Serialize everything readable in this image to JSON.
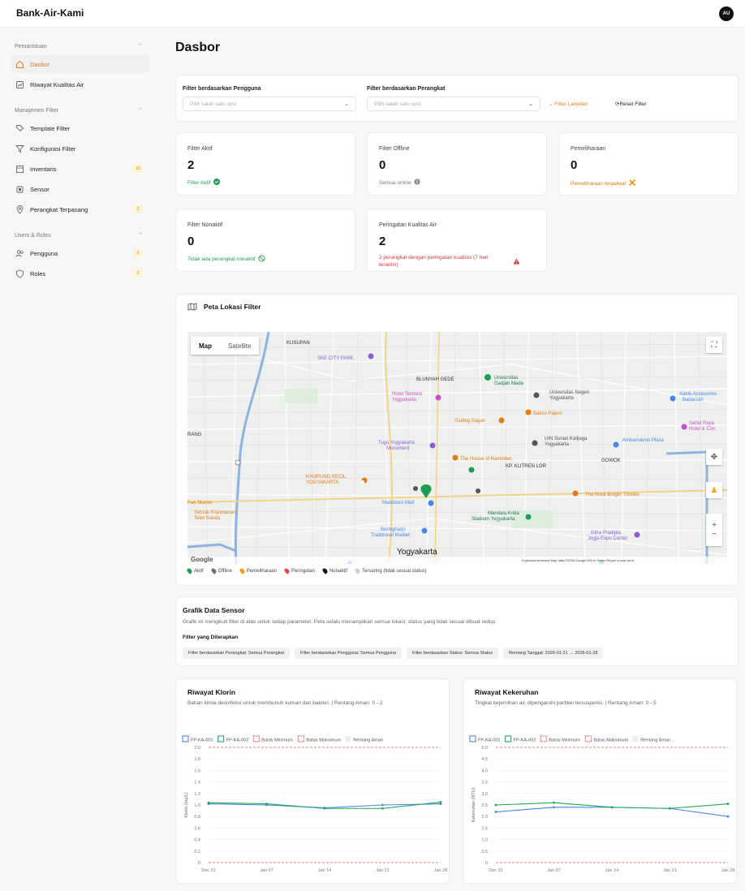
{
  "app": {
    "title": "Bank-Air-Kami",
    "user_initials": "AU"
  },
  "sidebar": {
    "sections": [
      {
        "title": "Pemantauan",
        "items": [
          {
            "label": "Dasbor",
            "icon": "home-icon",
            "active": true,
            "badge": ""
          },
          {
            "label": "Riwayat Kualitas Air",
            "icon": "chart-icon",
            "active": false,
            "badge": ""
          }
        ]
      },
      {
        "title": "Manajemen Filter",
        "items": [
          {
            "label": "Template Filter",
            "icon": "tag-icon",
            "active": false,
            "badge": ""
          },
          {
            "label": "Konfigurasi Filter",
            "icon": "funnel-icon",
            "active": false,
            "badge": ""
          },
          {
            "label": "Inventaris",
            "icon": "box-icon",
            "active": false,
            "badge": "15"
          },
          {
            "label": "Sensor",
            "icon": "cpu-icon",
            "active": false,
            "badge": ""
          },
          {
            "label": "Perangkat Terpasang",
            "icon": "location-icon",
            "active": false,
            "badge": "2"
          }
        ]
      },
      {
        "title": "Users & Roles",
        "items": [
          {
            "label": "Pengguna",
            "icon": "users-icon",
            "active": false,
            "badge": "2"
          },
          {
            "label": "Roles",
            "icon": "shield-icon",
            "active": false,
            "badge": "2"
          }
        ]
      }
    ]
  },
  "page": {
    "title": "Dasbor"
  },
  "filters": {
    "user_label": "Filter berdasarkan Pengguna",
    "user_placeholder": "Pilih salah satu opsi",
    "device_label": "Filter berdasarkan Perangkat",
    "device_placeholder": "Pilih salah satu opsi",
    "advanced": "Filter Lanjutan",
    "reset": "Reset Filter"
  },
  "stats": [
    {
      "title": "Filter Aktif",
      "value": "2",
      "sub": "Filter Aktif",
      "color": "green",
      "icon": "check-circle-icon"
    },
    {
      "title": "Filter Offline",
      "value": "0",
      "sub": "Semua online",
      "color": "gray",
      "icon": "info-icon"
    },
    {
      "title": "Pemeliharaan",
      "value": "0",
      "sub": "Pemeliharaan terjadwal",
      "color": "orange",
      "icon": "tools-icon"
    },
    {
      "title": "Filter Nonaktif",
      "value": "0",
      "sub": "Tidak ada perangkat nonaktif",
      "color": "green",
      "icon": "ban-icon"
    },
    {
      "title": "Peringatan Kualitas Air",
      "value": "2",
      "sub": "2 perangkat dengan peringatan kualitas (7 hari terakhir)",
      "color": "red",
      "icon": "warning-icon"
    }
  ],
  "map": {
    "title": "Peta Lokasi Filter",
    "tab_map": "Map",
    "tab_satellite": "Satellite",
    "google": "Google",
    "attribution": "Keyboard shortcuts   Map data ©2026 Google   500 m   Terms   Report a map error",
    "labels": [
      "SKE CITY PARK",
      "BLUNYAH GEDE",
      "Universitas Gadjah Mada",
      "Hotel Tentrem Yogyakarta",
      "Universitas Negeri Yogyakarta",
      "Gudeg Sagan",
      "Bakso Pajero",
      "Tugu Yogyakarta Monument",
      "The House of Raminten",
      "KP. KLITREN LOR",
      "UIN Sunan Kalijaga Yogyakarta",
      "Ambarrukmo Plaza",
      "GOWOK",
      "KAMPUNG KECIL YOGYAKARTA",
      "Malioboro Mall",
      "The Rock Burger Timoho",
      "Mandala Krida Stadium Yogyakarta",
      "Beringharjo Traditional Market",
      "Yogyakarta",
      "Gitra Pradipta Jogja Expo Center",
      "Sebrak Prasmanan Tetet Sunda",
      "Adele Accesories Babarsari",
      "Sahid Raya Hotel & Con",
      "KUSUPAN",
      "RANG",
      "Pak Slamet"
    ],
    "legend": [
      {
        "label": "Aktif",
        "color": "#1f9d55"
      },
      {
        "label": "Offline",
        "color": "#6b7280"
      },
      {
        "label": "Pemeliharaan",
        "color": "#f59e0b"
      },
      {
        "label": "Peringatan",
        "color": "#ef4444"
      },
      {
        "label": "Nonaktif",
        "color": "#111111"
      },
      {
        "label": "Tersaring (tidak sesuai status)",
        "color": "#cfcfd4"
      }
    ]
  },
  "sensor": {
    "title": "Grafik Data Sensor",
    "desc": "Grafik ini mengikuti filter di atas untuk setiap parameter. Peta selalu menampilkan semua lokasi; status yang tidak sesuai dibuat redup.",
    "applied_title": "Filter yang Diterapkan",
    "chips": [
      "Filter berdasarkan Perangkat: Semua Perangkat",
      "Filter berdasarkan Pengguna: Semua Pengguna",
      "Filter berdasarkan Status: Semua Status",
      "Rentang Tanggal: 2026-01-21 → 2026-01-28"
    ]
  },
  "charts": {
    "klorin": {
      "title": "Riwayat Klorin",
      "desc": "Bahan kimia desinfeksi untuk membunuh kuman dan bakteri. | Rentang Aman: 0 - 2"
    },
    "kekeruhan": {
      "title": "Riwayat Kekeruhan",
      "desc": "Tingkat kejernihan air, dipengaruhi partikel tersuspensi. | Rentang Aman: 0 - 5"
    }
  },
  "chart_data": [
    {
      "type": "line",
      "title": "Riwayat Klorin",
      "ylabel": "Klorin (mg/L)",
      "xlabel": "",
      "ylim": [
        0,
        2.0
      ],
      "yticks": [
        "0",
        "0.2",
        "0.4",
        "0.6",
        "0.8",
        "1.0",
        "1.2",
        "1.4",
        "1.6",
        "1.8",
        "2.0"
      ],
      "xticks": [
        "Dec 31",
        "Jan 07",
        "Jan 14",
        "Jan 21",
        "Jan 28"
      ],
      "x": [
        0,
        1,
        2,
        3,
        4
      ],
      "series": [
        {
          "name": "FP-KA-001",
          "color": "#4a86e8",
          "values": [
            1.02,
            1.0,
            0.95,
            1.0,
            1.02
          ]
        },
        {
          "name": "FP-KA-002",
          "color": "#22a55a",
          "values": [
            1.04,
            1.02,
            0.94,
            0.94,
            1.05
          ]
        }
      ],
      "legend": [
        "FP-KA-001",
        "FP-KA-002",
        "Batas Minimum",
        "Batas Maksimum",
        "Rentang Aman"
      ],
      "threshold_min": 0,
      "threshold_max": 2.0
    },
    {
      "type": "line",
      "title": "Riwayat Kekeruhan",
      "ylabel": "Kekeruhan (NTU)",
      "xlabel": "",
      "ylim": [
        0,
        5.0
      ],
      "yticks": [
        "0",
        "0.5",
        "1.0",
        "1.5",
        "2.0",
        "2.5",
        "3.0",
        "3.5",
        "4.0",
        "4.5",
        "5.0"
      ],
      "xticks": [
        "Dec 31",
        "Jan 07",
        "Jan 14",
        "Jan 21",
        "Jan 28"
      ],
      "x": [
        0,
        1,
        2,
        3,
        4
      ],
      "series": [
        {
          "name": "FP-KA-001",
          "color": "#4a86e8",
          "values": [
            2.2,
            2.4,
            2.4,
            2.35,
            2.0
          ]
        },
        {
          "name": "FP-KA-002",
          "color": "#22a55a",
          "values": [
            2.5,
            2.6,
            2.4,
            2.35,
            2.55
          ]
        }
      ],
      "legend": [
        "FP-KA-001",
        "FP-KA-002",
        "Batas Minimum",
        "Batas Maksimum",
        "Rentang Aman"
      ],
      "threshold_min": 0,
      "threshold_max": 5.0
    }
  ]
}
